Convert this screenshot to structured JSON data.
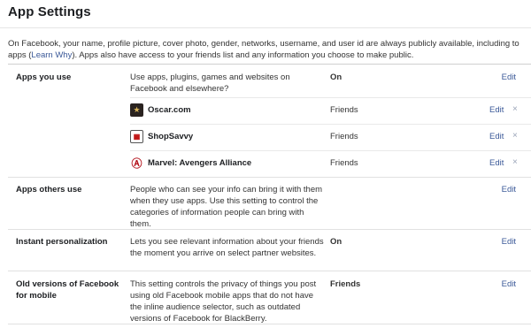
{
  "header": {
    "title": "App Settings"
  },
  "intro": {
    "text_before": "On Facebook, your name, profile picture, cover photo, gender, networks, username, and user id are always publicly available, including to apps (",
    "link": "Learn Why",
    "text_after": "). Apps also have access to your friends list and any information you choose to make public."
  },
  "sections": {
    "apps_you_use": {
      "label": "Apps you use",
      "description": "Use apps, plugins, games and websites on Facebook and elsewhere?",
      "setting": "On",
      "edit": "Edit",
      "apps": [
        {
          "name": "Oscar.com",
          "setting": "Friends",
          "edit": "Edit",
          "remove": "×",
          "icon": "oscar-app-icon"
        },
        {
          "name": "ShopSavvy",
          "setting": "Friends",
          "edit": "Edit",
          "remove": "×",
          "icon": "shopsavvy-app-icon"
        },
        {
          "name": "Marvel: Avengers Alliance",
          "setting": "Friends",
          "edit": "Edit",
          "remove": "×",
          "icon": "marvel-app-icon"
        }
      ]
    },
    "apps_others_use": {
      "label": "Apps others use",
      "description": "People who can see your info can bring it with them when they use apps. Use this setting to control the categories of information people can bring with them.",
      "edit": "Edit"
    },
    "instant_personalization": {
      "label": "Instant personalization",
      "description": "Lets you see relevant information about your friends the moment you arrive on select partner websites.",
      "setting": "On",
      "edit": "Edit"
    },
    "old_versions": {
      "label": "Old versions of Facebook for mobile",
      "description": "This setting controls the privacy of things you post using old Facebook mobile apps that do not have the inline audience selector, such as outdated versions of Facebook for BlackBerry.",
      "setting": "Friends",
      "edit": "Edit"
    }
  },
  "colors": {
    "link": "#3b5998",
    "text": "#333333",
    "divider": "#e1e1e1"
  }
}
